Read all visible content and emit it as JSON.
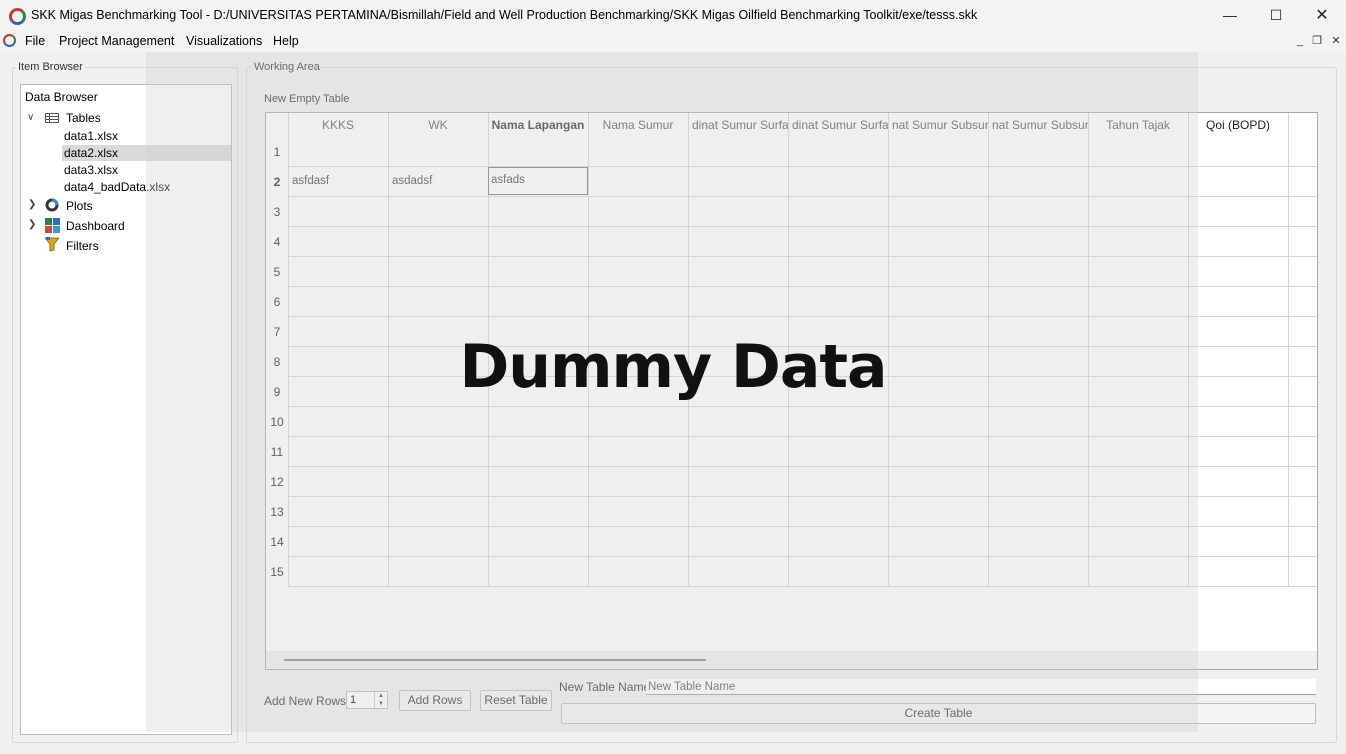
{
  "window": {
    "title": "SKK Migas Benchmarking Tool - D:/UNIVERSITAS PERTAMINA/Bismillah/Field and Well Production Benchmarking/SKK Migas Oilfield Benchmarking Toolkit/exe/tesss.skk",
    "minimize_icon": "minimize-icon",
    "maximize_icon": "maximize-icon",
    "close_icon": "close-icon"
  },
  "menu": {
    "items": [
      "File",
      "Project Management",
      "Visualizations",
      "Help"
    ]
  },
  "item_browser": {
    "group_title": "Item Browser",
    "root": "Data Browser",
    "tables_label": "Tables",
    "tables": [
      "data1.xlsx",
      "data2.xlsx",
      "data3.xlsx",
      "data4_badData.xlsx"
    ],
    "selected_table": "data2.xlsx",
    "plots_label": "Plots",
    "dashboard_label": "Dashboard",
    "filters_label": "Filters"
  },
  "working_area": {
    "group_title": "Working Area",
    "table_title": "New Empty Table",
    "columns": [
      "KKKS",
      "WK",
      "Nama Lapangan",
      "Nama Sumur",
      "dinat Sumur Surfa",
      "dinat Sumur Surfa",
      "nat Sumur Subsur",
      "nat Sumur Subsur",
      "Tahun Tajak",
      "Qoi (BOPD)"
    ],
    "bold_column": "Nama Lapangan",
    "rows": [
      "1",
      "2",
      "3",
      "4",
      "5",
      "6",
      "7",
      "8",
      "9",
      "10",
      "11",
      "12",
      "13",
      "14",
      "15"
    ],
    "row2_values": [
      "asfdasf",
      "asdadsf",
      "asfads"
    ]
  },
  "controls": {
    "add_new_rows_label": "Add New Rows:",
    "rows_value": "1",
    "add_rows_button": "Add Rows",
    "reset_table_button": "Reset Table",
    "new_table_name_label": "New Table Name",
    "new_table_name_placeholder": "New Table Name",
    "create_table_button": "Create Table"
  },
  "overlay_text": "Dummy Data"
}
